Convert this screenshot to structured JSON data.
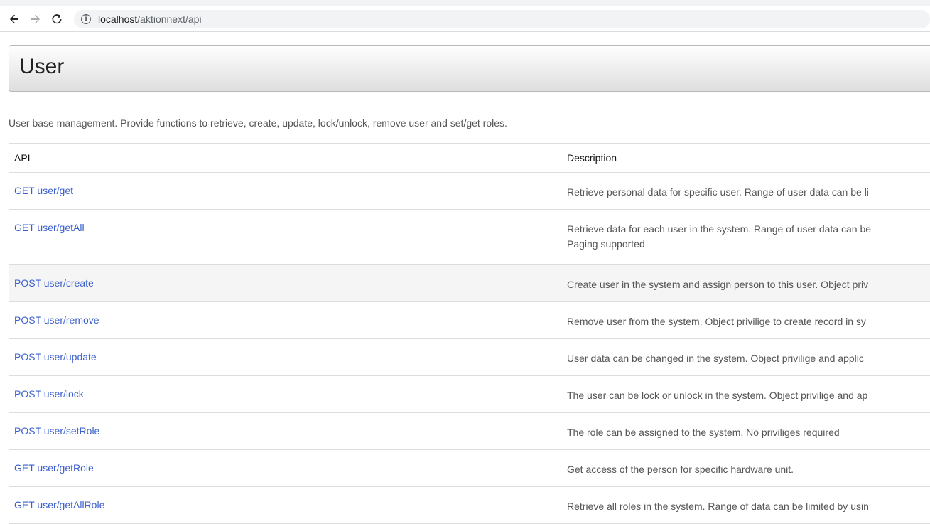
{
  "browser": {
    "back_icon": "arrow-left-icon",
    "forward_icon": "arrow-right-icon",
    "reload_icon": "reload-icon",
    "info_icon": "info-icon",
    "url_host": "localhost",
    "url_path": "/aktionnext/api"
  },
  "header": {
    "title": "User"
  },
  "description": "User base management. Provide functions to retrieve, create, update, lock/unlock, remove user and set/get roles.",
  "table": {
    "columns": [
      "API",
      "Description"
    ],
    "rows": [
      {
        "api": "GET user/get",
        "desc": "Retrieve personal data for specific user. Range of user data can be li"
      },
      {
        "api": "GET user/getAll",
        "desc": "Retrieve data for each user in the system. Range of user data can be",
        "desc2": "Paging supported"
      },
      {
        "api": "POST user/create",
        "desc": "Create user in the system and assign person to this user. Object priv"
      },
      {
        "api": "POST user/remove",
        "desc": "Remove user from the system. Object privilige to create record in sy"
      },
      {
        "api": "POST user/update",
        "desc": "User data can be changed in the system. Object privilige and applic"
      },
      {
        "api": "POST user/lock",
        "desc": "The user can be lock or unlock in the system. Object privilige and ap"
      },
      {
        "api": "POST user/setRole",
        "desc": "The role can be assigned to the system. No priviliges required"
      },
      {
        "api": "GET user/getRole",
        "desc": "Get access of the person for specific hardware unit."
      },
      {
        "api": "GET user/getAllRole",
        "desc": "Retrieve all roles in the system. Range of data can be limited by usin"
      }
    ]
  },
  "colors": {
    "link": "#3a5fcd",
    "row_highlight": "#f5f5f5"
  }
}
